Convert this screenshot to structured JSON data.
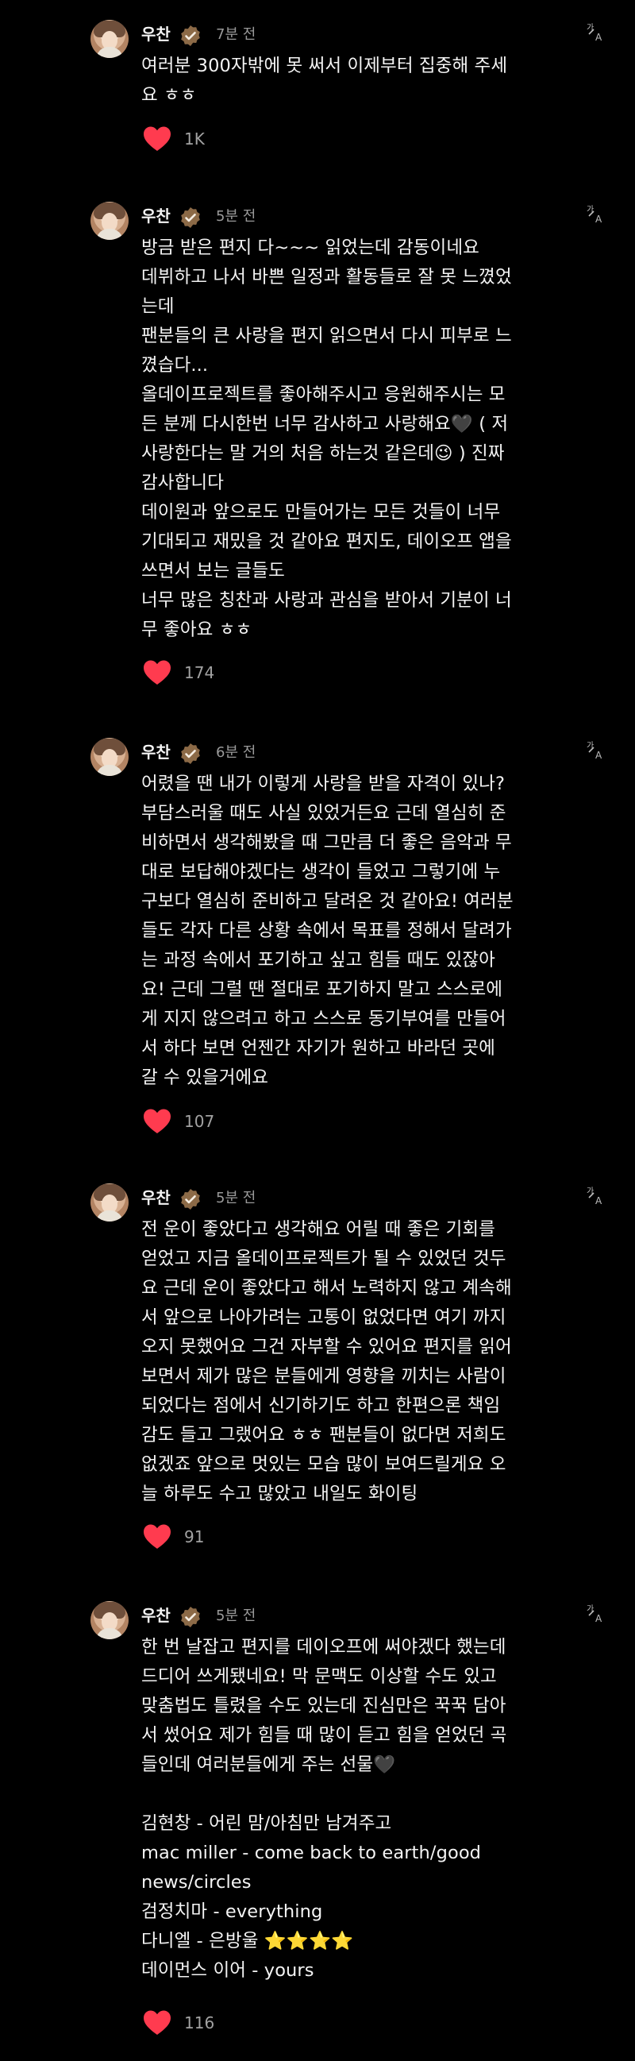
{
  "posts": [
    {
      "author": "우찬",
      "time": "7분 전",
      "body": "여러분 300자밖에 못 써서 이제부터 집중해 주세\n요 ㅎㅎ",
      "likes": "1K"
    },
    {
      "author": "우찬",
      "time": "5분 전",
      "body": "방금 받은 편지 다~~~ 읽었는데 감동이네요\n데뷔하고 나서 바쁜 일정과 활동들로 잘 못 느꼈었\n는데\n팬분들의 큰 사랑을 편지 읽으면서 다시 피부로 느\n꼈습다...\n올데이프로젝트를 좋아해주시고 응원해주시는 모\n든 분께 다시한번 너무 감사하고 사랑해요🖤 ( 저\n사랑한다는 말 거의 처음 하는것 같은데😉 ) 진짜\n감사합니다\n데이원과 앞으로도 만들어가는 모든 것들이 너무\n기대되고 재밌을 것 같아요 편지도, 데이오프 앱을\n쓰면서 보는 글들도\n너무 많은 칭찬과 사랑과 관심을 받아서 기분이 너\n무 좋아요 ㅎㅎ",
      "likes": "174"
    },
    {
      "author": "우찬",
      "time": "6분 전",
      "body": "어렸을 땐 내가 이렇게 사랑을 받을 자격이 있나?\n부담스러울 때도 사실 있었거든요 근데 열심히 준\n비하면서 생각해봤을 때 그만큼 더 좋은 음악과 무\n대로 보답해야겠다는 생각이 들었고 그렇기에 누\n구보다 열심히 준비하고 달려온 것 같아요! 여러분\n들도 각자 다른 상황 속에서 목표를 정해서 달려가\n는 과정 속에서 포기하고 싶고 힘들 때도 있잖아\n요! 근데 그럴 땐 절대로 포기하지 말고 스스로에\n게 지지 않으려고 하고 스스로 동기부여를 만들어\n서 하다 보면 언젠간 자기가 원하고 바라던 곳에\n갈 수 있을거에요",
      "likes": "107"
    },
    {
      "author": "우찬",
      "time": "5분 전",
      "body": "전 운이 좋았다고 생각해요 어릴 때 좋은 기회를\n얻었고 지금 올데이프로젝트가 될 수 있었던 것두\n요 근데 운이 좋았다고 해서 노력하지 않고 계속해\n서 앞으로 나아가려는 고통이 없었다면 여기 까지\n오지 못했어요 그건 자부할 수 있어요 편지를 읽어\n보면서 제가 많은 분들에게 영향을 끼치는 사람이\n되었다는 점에서 신기하기도 하고 한편으론 책임\n감도 들고 그랬어요 ㅎㅎ 팬분들이 없다면 저희도\n없겠죠 앞으로 멋있는 모습 많이 보여드릴게요 오\n늘 하루도 수고 많았고 내일도 화이팅",
      "likes": "91"
    },
    {
      "author": "우찬",
      "time": "5분 전",
      "body": "한 번 날잡고 편지를 데이오프에 써야겠다 했는데\n드디어 쓰게됐네요! 막 문맥도 이상할 수도 있고\n맞춤법도 틀렸을 수도 있는데 진심만은 꾹꾹 담아\n서 썼어요 제가 힘들 때 많이 듣고 힘을 얻었던 곡\n들인데 여러분들에게 주는 선물🖤\n\n김현창 - 어린 맘/아침만 남겨주고\nmac miller - come back to earth/good\nnews/circles\n검정치마 - everything\n다니엘 - 은방울 ⭐⭐⭐⭐\n데이먼스 이어 - yours",
      "likes": "116"
    }
  ],
  "icons": {
    "verified": "verified-badge-icon",
    "translate": "translate-icon",
    "heart": "heart-icon"
  },
  "colors": {
    "background": "#000000",
    "text": "#f4f4f4",
    "muted": "#9a9a9a",
    "heart": "#ff3b4f",
    "badge": "#8c6a47"
  }
}
